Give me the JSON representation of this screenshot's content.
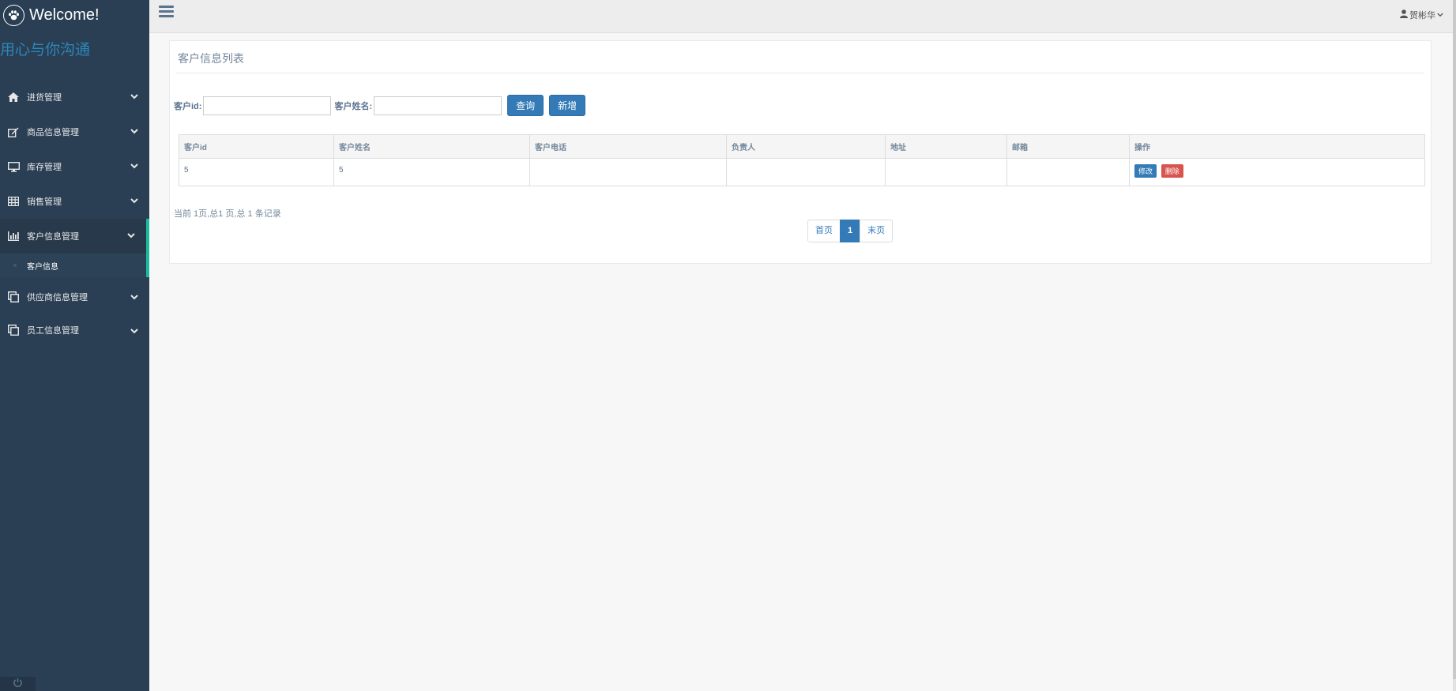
{
  "brand": {
    "title": "Welcome!",
    "slogan": "用心与你沟通"
  },
  "sidebar": {
    "items": [
      {
        "label": "进货管理",
        "icon": "home-icon"
      },
      {
        "label": "商品信息管理",
        "icon": "edit-icon"
      },
      {
        "label": "库存管理",
        "icon": "desktop-icon"
      },
      {
        "label": "销售管理",
        "icon": "table-icon"
      },
      {
        "label": "客户信息管理",
        "icon": "bar-chart-icon",
        "active": true
      },
      {
        "label": "供应商信息管理",
        "icon": "clone-icon"
      },
      {
        "label": "员工信息管理",
        "icon": "clone-icon"
      }
    ],
    "submenu": {
      "label": "客户信息"
    }
  },
  "header": {
    "user": "贺彬华"
  },
  "panel": {
    "title": "客户信息列表",
    "search": {
      "id_label": "客户id:",
      "name_label": "客户姓名:",
      "id_value": "",
      "name_value": "",
      "query_label": "查询",
      "add_label": "新增"
    },
    "table": {
      "headers": [
        "客户id",
        "客户姓名",
        "客户电话",
        "负责人",
        "地址",
        "邮箱",
        "操作"
      ],
      "rows": [
        {
          "id": "5",
          "name": "5",
          "phone": "",
          "manager": "",
          "address": "",
          "email": ""
        }
      ],
      "edit_label": "修改",
      "delete_label": "删除"
    },
    "page_info": "当前 1页,总1 页,总 1 条记录",
    "pagination": {
      "first": "首页",
      "current": "1",
      "last": "末页"
    }
  },
  "colors": {
    "sidebar_bg": "#2a3f54",
    "active_border": "#1abb9c",
    "primary": "#337ab7",
    "danger": "#d9534f",
    "slogan": "#2d86b9"
  }
}
